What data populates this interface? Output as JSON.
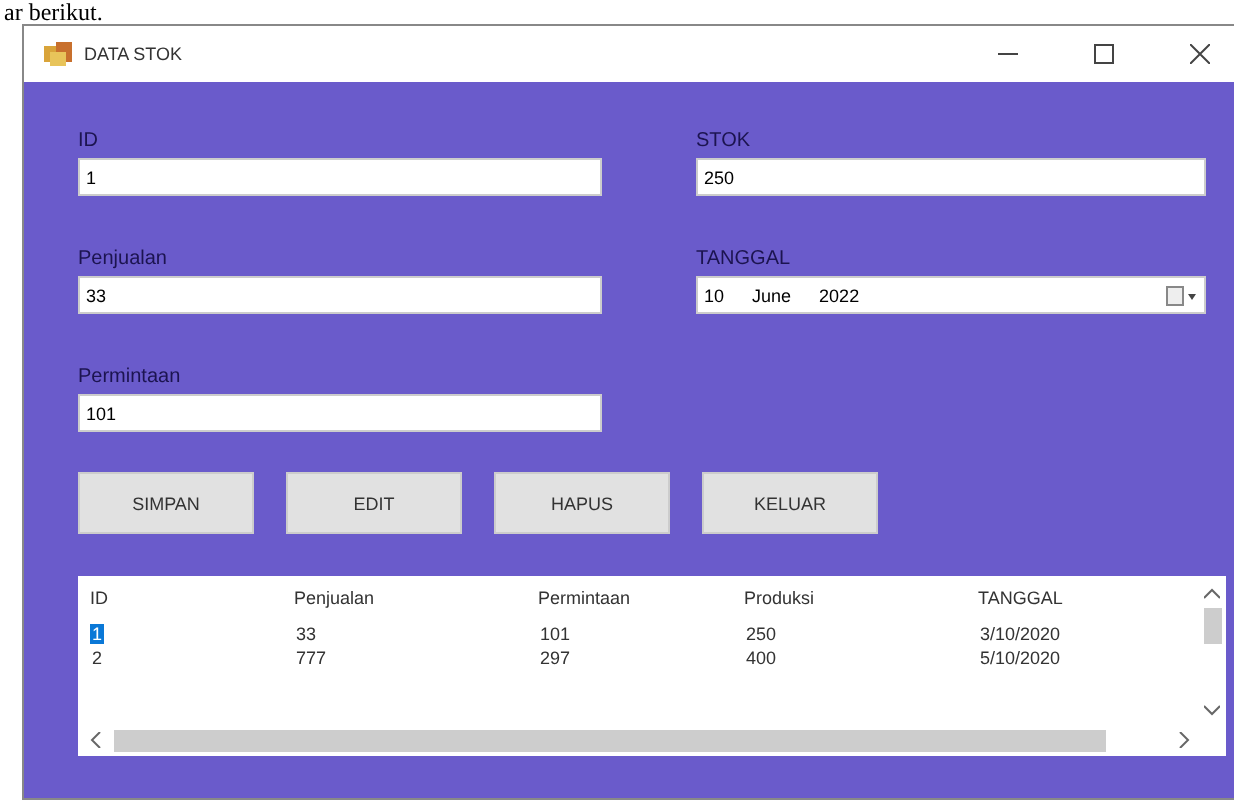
{
  "caption": "ar berikut.",
  "window": {
    "title": "DATA STOK"
  },
  "fields": [
    {
      "label": "ID",
      "value": "1",
      "kind": "text"
    },
    {
      "label": "STOK",
      "value": "250",
      "kind": "text"
    },
    {
      "label": "Penjualan",
      "value": "33",
      "kind": "text"
    },
    {
      "label": "TANGGAL",
      "kind": "date",
      "day": "10",
      "month": "June",
      "year": "2022"
    },
    {
      "label": "Permintaan",
      "value": "101",
      "kind": "text"
    }
  ],
  "buttons": [
    "SIMPAN",
    "EDIT",
    "HAPUS",
    "KELUAR"
  ],
  "table": {
    "columns": [
      "ID",
      "Penjualan",
      "Permintaan",
      "Produksi",
      "TANGGAL"
    ],
    "rows": [
      {
        "cells": [
          "1",
          "33",
          "101",
          "250",
          "3/10/2020"
        ],
        "selected": true
      },
      {
        "cells": [
          "2",
          "777",
          "297",
          "400",
          "5/10/2020"
        ],
        "selected": false
      }
    ]
  }
}
